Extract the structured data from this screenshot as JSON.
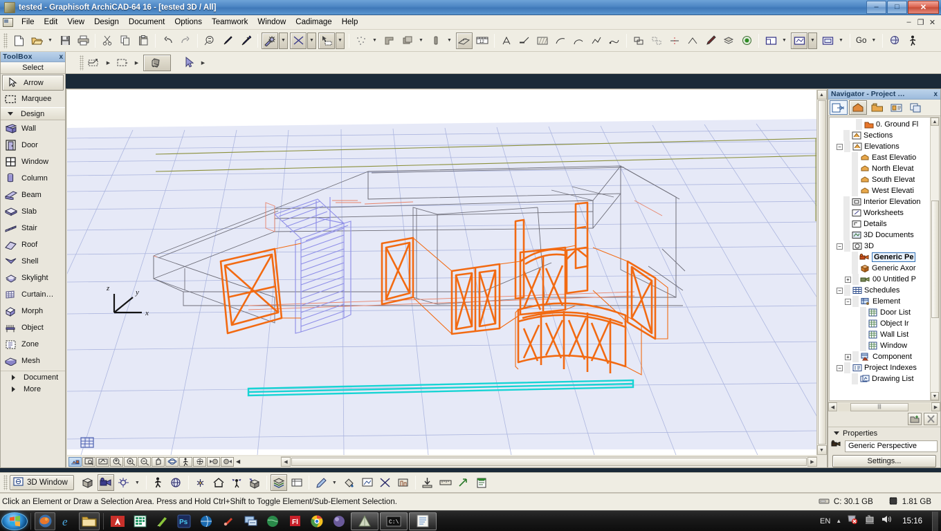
{
  "window": {
    "title": "tested - Graphisoft ArchiCAD-64 16 - [tested 3D / All]",
    "minimize": "–",
    "maximize": "□",
    "close": "✕",
    "mdi_minimize": "–",
    "mdi_restore": "❐",
    "mdi_close": "✕"
  },
  "menu": {
    "items": [
      "File",
      "Edit",
      "View",
      "Design",
      "Document",
      "Options",
      "Teamwork",
      "Window",
      "Cadimage",
      "Help"
    ]
  },
  "toolbar": {
    "go_label": "Go",
    "groups": [
      {
        "buttons": [
          "new-icon",
          "open-icon",
          "save-icon",
          "print-icon"
        ]
      },
      {
        "buttons": [
          "cut-icon",
          "copy-icon",
          "paste-icon"
        ]
      },
      {
        "buttons": [
          "undo-icon",
          "redo-icon"
        ]
      },
      {
        "buttons": [
          "find-icon",
          "eyedropper-icon",
          "syringe-icon"
        ]
      }
    ]
  },
  "toolbox": {
    "title": "ToolBox",
    "close": "x",
    "header": "Select",
    "items": [
      {
        "label": "Arrow",
        "icon": "arrow-icon",
        "type": "tool",
        "selected": true
      },
      {
        "label": "Marquee",
        "icon": "marquee-icon",
        "type": "tool",
        "selected": false
      },
      {
        "label": "Design",
        "icon": "triangle-down",
        "type": "group"
      },
      {
        "label": "Wall",
        "icon": "wall-icon",
        "type": "tool",
        "selected": false
      },
      {
        "label": "Door",
        "icon": "door-icon",
        "type": "tool",
        "selected": false
      },
      {
        "label": "Window",
        "icon": "window-icon",
        "type": "tool",
        "selected": false
      },
      {
        "label": "Column",
        "icon": "column-icon",
        "type": "tool",
        "selected": false
      },
      {
        "label": "Beam",
        "icon": "beam-icon",
        "type": "tool",
        "selected": false
      },
      {
        "label": "Slab",
        "icon": "slab-icon",
        "type": "tool",
        "selected": false
      },
      {
        "label": "Stair",
        "icon": "stair-icon",
        "type": "tool",
        "selected": false
      },
      {
        "label": "Roof",
        "icon": "roof-icon",
        "type": "tool",
        "selected": false
      },
      {
        "label": "Shell",
        "icon": "shell-icon",
        "type": "tool",
        "selected": false
      },
      {
        "label": "Skylight",
        "icon": "skylight-icon",
        "type": "tool",
        "selected": false
      },
      {
        "label": "Curtain…",
        "icon": "curtainwall-icon",
        "type": "tool",
        "selected": false
      },
      {
        "label": "Morph",
        "icon": "morph-icon",
        "type": "tool",
        "selected": false
      },
      {
        "label": "Object",
        "icon": "object-icon",
        "type": "tool",
        "selected": false
      },
      {
        "label": "Zone",
        "icon": "zone-icon",
        "type": "tool",
        "selected": false
      },
      {
        "label": "Mesh",
        "icon": "mesh-icon",
        "type": "tool",
        "selected": false
      },
      {
        "label": "Document",
        "icon": "triangle-right",
        "type": "collapsed"
      },
      {
        "label": "More",
        "icon": "triangle-right",
        "type": "collapsed"
      }
    ]
  },
  "navigator": {
    "title": "Navigator - Project …",
    "close": "x",
    "tree": [
      {
        "label": "0. Ground Fl",
        "icon": "story-icon",
        "depth": 3,
        "expander": "",
        "selected": false
      },
      {
        "label": "Sections",
        "icon": "section-icon",
        "depth": 2,
        "expander": "",
        "selected": false
      },
      {
        "label": "Elevations",
        "icon": "elevation-icon",
        "depth": 2,
        "expander": "-",
        "selected": false
      },
      {
        "label": "East Elevatio",
        "icon": "elev-item-icon",
        "depth": 3,
        "expander": "",
        "selected": false
      },
      {
        "label": "North Elevat",
        "icon": "elev-item-icon",
        "depth": 3,
        "expander": "",
        "selected": false
      },
      {
        "label": "South Elevat",
        "icon": "elev-item-icon",
        "depth": 3,
        "expander": "",
        "selected": false
      },
      {
        "label": "West Elevati",
        "icon": "elev-item-icon",
        "depth": 3,
        "expander": "",
        "selected": false
      },
      {
        "label": "Interior Elevation",
        "icon": "interior-elev-icon",
        "depth": 2,
        "expander": "",
        "selected": false
      },
      {
        "label": "Worksheets",
        "icon": "worksheet-icon",
        "depth": 2,
        "expander": "",
        "selected": false
      },
      {
        "label": "Details",
        "icon": "detail-icon",
        "depth": 2,
        "expander": "",
        "selected": false
      },
      {
        "label": "3D Documents",
        "icon": "doc3d-icon",
        "depth": 2,
        "expander": "",
        "selected": false
      },
      {
        "label": "3D",
        "icon": "view3d-icon",
        "depth": 2,
        "expander": "-",
        "selected": false
      },
      {
        "label": "Generic Pe",
        "icon": "camera-icon",
        "depth": 3,
        "expander": "",
        "selected": true
      },
      {
        "label": "Generic Axor",
        "icon": "axono-icon",
        "depth": 3,
        "expander": "",
        "selected": false
      },
      {
        "label": "00 Untitled P",
        "icon": "camera-icon",
        "depth": 3,
        "expander": "+",
        "selected": false
      },
      {
        "label": "Schedules",
        "icon": "schedule-icon",
        "depth": 2,
        "expander": "-",
        "selected": false
      },
      {
        "label": "Element",
        "icon": "element-icon",
        "depth": 3,
        "expander": "-",
        "selected": false
      },
      {
        "label": "Door List",
        "icon": "list-icon",
        "depth": 4,
        "expander": "",
        "selected": false
      },
      {
        "label": "Object Ir",
        "icon": "list-icon",
        "depth": 4,
        "expander": "",
        "selected": false
      },
      {
        "label": "Wall List",
        "icon": "list-icon",
        "depth": 4,
        "expander": "",
        "selected": false
      },
      {
        "label": "Window",
        "icon": "list-icon",
        "depth": 4,
        "expander": "",
        "selected": false
      },
      {
        "label": "Component",
        "icon": "component-icon",
        "depth": 3,
        "expander": "+",
        "selected": false
      },
      {
        "label": "Project Indexes",
        "icon": "index-icon",
        "depth": 2,
        "expander": "-",
        "selected": false
      },
      {
        "label": "Drawing List",
        "icon": "drawing-icon",
        "depth": 3,
        "expander": "",
        "selected": false
      }
    ],
    "properties": {
      "section_label": "Properties",
      "value": "Generic Perspective",
      "settings_button": "Settings..."
    }
  },
  "viewport": {
    "axis": {
      "x": "x",
      "y": "y",
      "z": "z"
    }
  },
  "bottom_toolbar": {
    "window_label": "3D Window"
  },
  "statusbar": {
    "message": "Click an Element or Draw a Selection Area. Press and Hold Ctrl+Shift to Toggle Element/Sub-Element Selection.",
    "disk": "C: 30.1 GB",
    "memory": "1.81 GB"
  },
  "taskbar": {
    "language": "EN",
    "clock": "15:16",
    "apps": [
      "firefox-icon",
      "internet-explorer-icon",
      "file-explorer-icon",
      "autocad-icon",
      "spreadsheet-icon",
      "sketchup-icon",
      "photoshop-icon",
      "globe-icon",
      "unknown-red-icon",
      "remote-desktop-icon",
      "earth-icon",
      "flash-icon",
      "chrome-icon",
      "browser-icon"
    ],
    "running": [
      "archicad-icon",
      "console-icon",
      "notepad-icon"
    ]
  },
  "colors": {
    "accent_orange": "#f26a12",
    "stair_violet": "#8f8fe8",
    "slab_cyan": "#17d4d4",
    "grid_blue": "#9aa8d6",
    "title_blue": "#4d86c4"
  }
}
